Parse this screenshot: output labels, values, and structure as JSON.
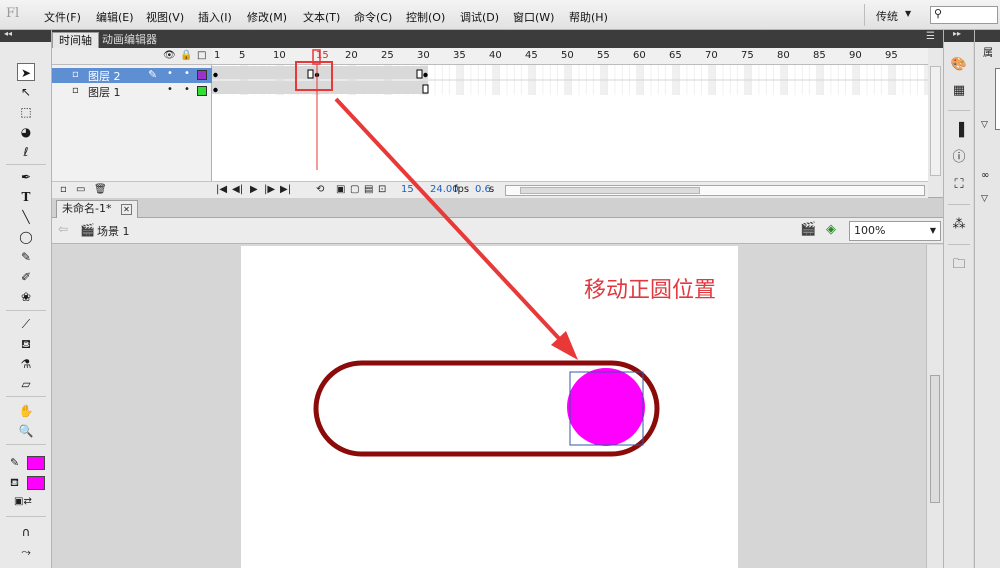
{
  "app": {
    "logo": "Fl"
  },
  "menu": [
    "文件(F)",
    "编辑(E)",
    "视图(V)",
    "插入(I)",
    "修改(M)",
    "文本(T)",
    "命令(C)",
    "控制(O)",
    "调试(D)",
    "窗口(W)",
    "帮助(H)"
  ],
  "workspace": {
    "label": "传统",
    "search_placeholder": ""
  },
  "timeline": {
    "tabs": [
      "时间轴",
      "动画编辑器"
    ],
    "active_tab": 0,
    "layers": [
      {
        "name": "图层 2",
        "color": "#9933cc",
        "selected": true
      },
      {
        "name": "图层 1",
        "color": "#33dd33",
        "selected": false
      }
    ],
    "ruler_ticks": [
      "1",
      "5",
      "10",
      "15",
      "20",
      "25",
      "30",
      "35",
      "40",
      "45",
      "50",
      "55",
      "60",
      "65",
      "70",
      "75",
      "80",
      "85",
      "90",
      "95"
    ],
    "current_frame": "15",
    "frame_rate": "24.00",
    "fps_unit": "fps",
    "elapsed": "0.6",
    "elapsed_unit": "s"
  },
  "document": {
    "tab_title": "未命名-1*",
    "scene": "场景 1",
    "zoom": "100%"
  },
  "stage": {
    "annotation": "移动正圆位置",
    "annotation_color": "#e0393f",
    "track_stroke": "#8b0a0a",
    "circle_fill": "#ff00ff"
  },
  "colors": {
    "stroke": "#ff00ff",
    "fill": "#ff00ff",
    "highlight": "#e83838"
  }
}
